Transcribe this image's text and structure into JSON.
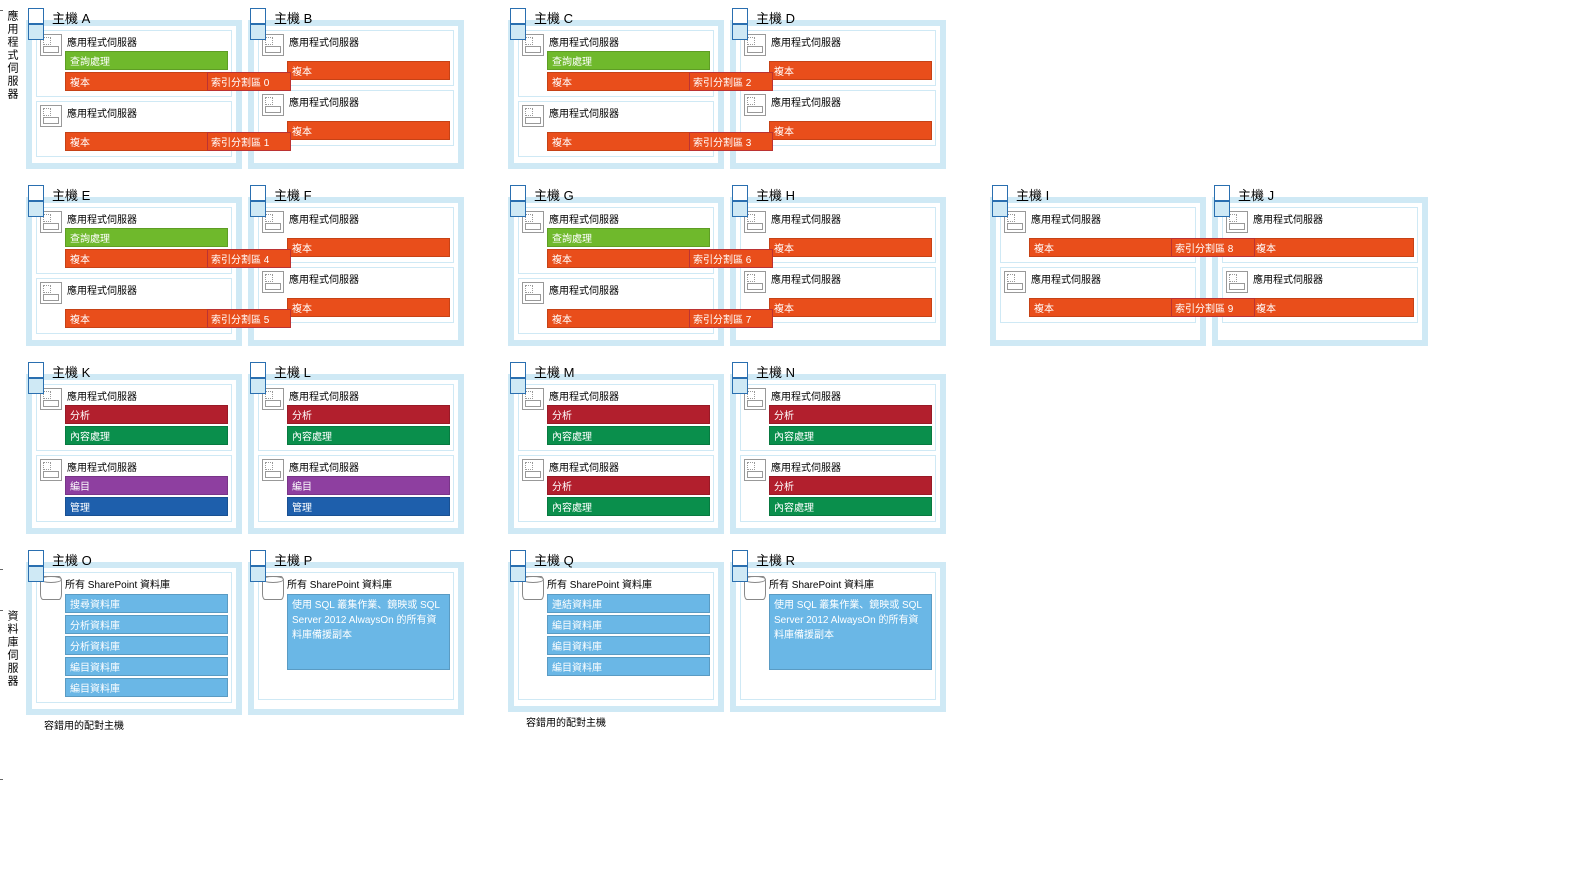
{
  "section_labels": {
    "app": "應用程式伺服器",
    "db": "資料庫伺服器"
  },
  "footnote": "容錯用的配對主機",
  "common": {
    "appserver": "應用程式伺服器",
    "sharepoint_db": "所有 SharePoint 資料庫"
  },
  "roles": {
    "query": "查詢處理",
    "replica": "複本",
    "analysis": "分析",
    "content": "內容處理",
    "index": "編目",
    "mgmt": "管理"
  },
  "partitions": [
    "索引分割區 0",
    "索引分割區 1",
    "索引分割區 2",
    "索引分割區 3",
    "索引分割區 4",
    "索引分割區 5",
    "索引分割區 6",
    "索引分割區 7",
    "索引分割區 8",
    "索引分割區 9"
  ],
  "hosts": {
    "A": "主機 A",
    "B": "主機 B",
    "C": "主機 C",
    "D": "主機 D",
    "E": "主機 E",
    "F": "主機 F",
    "G": "主機 G",
    "H": "主機 H",
    "I": "主機 I",
    "J": "主機 J",
    "K": "主機 K",
    "L": "主機 L",
    "M": "主機 M",
    "N": "主機 N",
    "O": "主機 O",
    "P": "主機 P",
    "Q": "主機 Q",
    "R": "主機 R"
  },
  "db_lists": {
    "O": [
      "搜尋資料庫",
      "分析資料庫",
      "分析資料庫",
      "編目資料庫",
      "編目資料庫"
    ],
    "Q": [
      "連結資料庫",
      "編目資料庫",
      "編目資料庫",
      "編目資料庫"
    ]
  },
  "db_text": {
    "mirror": "使用 SQL 叢集作業、鏡映或 SQL Server 2012 AlwaysOn 的所有資料庫備援副本"
  }
}
